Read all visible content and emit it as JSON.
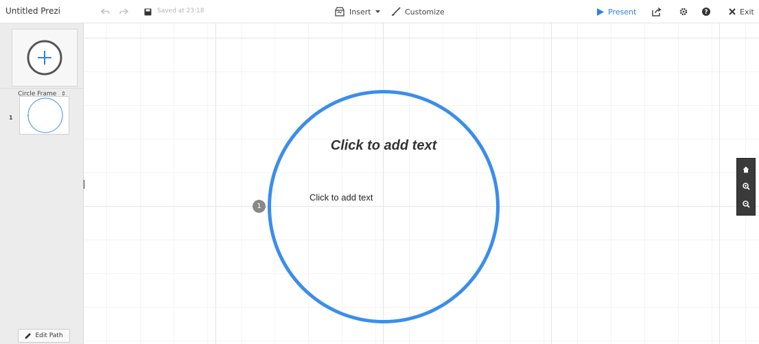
{
  "app": {
    "title": "Untitled Prezi"
  },
  "toolbar": {
    "undo_icon": "undo-icon",
    "redo_icon": "redo-icon",
    "save_icon": "save-icon",
    "saved_text": "Saved at 23:18",
    "insert_label": "Insert",
    "customize_label": "Customize",
    "present_label": "Present",
    "exit_label": "Exit",
    "accent_color": "#2a82e4"
  },
  "sidebar": {
    "frame_type": "Circle Frame",
    "frame_type_arrow": "⇕",
    "thumbnails": [
      {
        "number": "1"
      }
    ],
    "edit_path_label": "Edit Path"
  },
  "canvas": {
    "frame": {
      "shape": "circle",
      "color": "#3b8ded",
      "title_placeholder": "Click to add text",
      "body_placeholder": "Click to add text",
      "path_number": "1"
    }
  },
  "zoom": {
    "home_icon": "home-icon",
    "zoom_in_icon": "zoom-in-icon",
    "zoom_out_icon": "zoom-out-icon"
  }
}
